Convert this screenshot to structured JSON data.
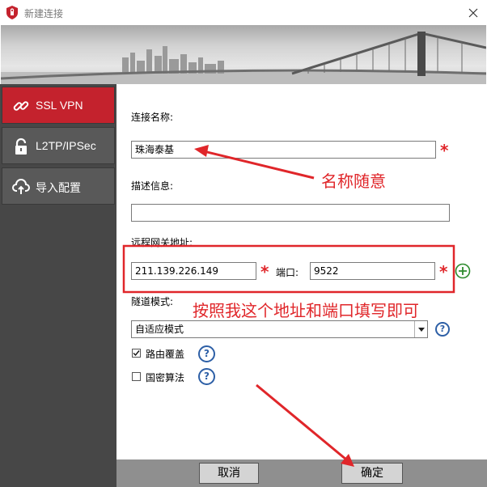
{
  "window": {
    "title": "新建连接",
    "close_icon": "close-icon"
  },
  "sidebar": {
    "items": [
      {
        "label": "SSL VPN",
        "icon": "link-icon",
        "active": true
      },
      {
        "label": "L2TP/IPSec",
        "icon": "lock-icon",
        "active": false
      },
      {
        "label": "导入配置",
        "icon": "cloud-upload-icon",
        "active": false
      }
    ]
  },
  "form": {
    "name_label": "连接名称:",
    "name_value": "珠海泰基",
    "desc_label": "描述信息:",
    "desc_value": "",
    "gateway_label": "远程网关地址:",
    "gateway_value": "211.139.226.149",
    "port_label": "端口:",
    "port_value": "9522",
    "tunnel_label": "隧道模式:",
    "tunnel_value": "自适应模式",
    "route_label": "路由覆盖",
    "route_checked": true,
    "crypto_label": "国密算法",
    "crypto_checked": false,
    "required_mark": "*"
  },
  "buttons": {
    "cancel": "取消",
    "ok": "确定"
  },
  "annotations": {
    "name_hint": "名称随意",
    "gateway_hint": "按照我这个地址和端口填写即可"
  },
  "colors": {
    "accent_red": "#c4222d",
    "annotation_red": "#e0262a",
    "help_blue": "#2d5fa6",
    "add_green": "#2e8b2e"
  }
}
